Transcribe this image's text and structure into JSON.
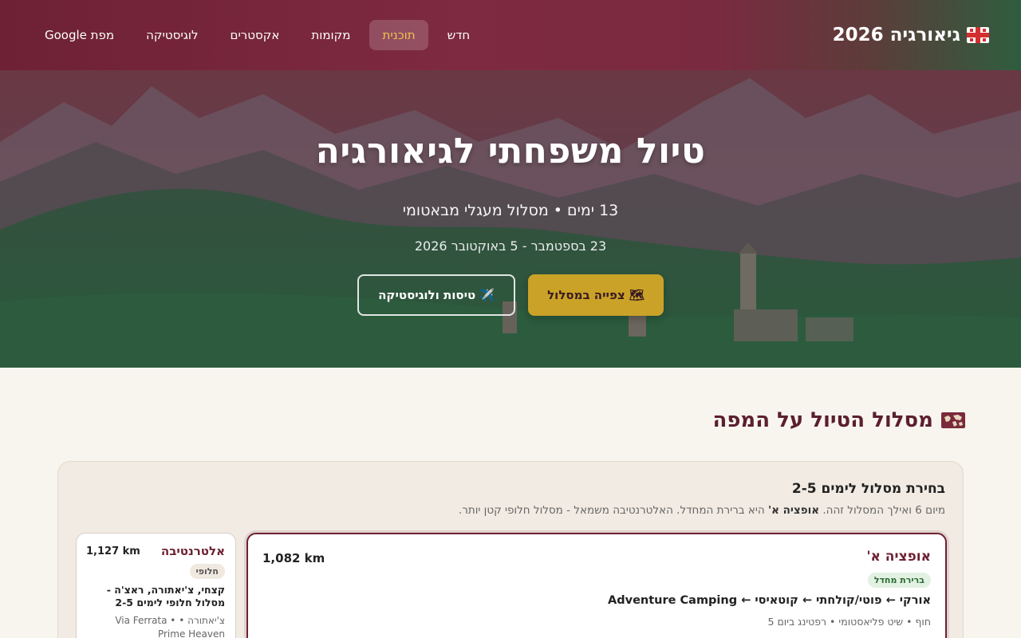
{
  "brand": {
    "title": "גיאורגיה 2026",
    "flag_icon": "georgia-flag-icon"
  },
  "nav": {
    "items": [
      {
        "label": "חדש",
        "active": false
      },
      {
        "label": "תוכנית",
        "active": true
      },
      {
        "label": "מקומות",
        "active": false
      },
      {
        "label": "אקסטרים",
        "active": false
      },
      {
        "label": "לוגיסטיקה",
        "active": false
      },
      {
        "label": "מפת Google",
        "active": false
      }
    ]
  },
  "hero": {
    "title": "טיול משפחתי לגיאורגיה",
    "subtitle": "13 ימים • מסלול מעגלי מבאטומי",
    "dates": "23 בספטמבר - 5 באוקטובר 2026",
    "primary_button": "🗺 צפייה במסלול",
    "secondary_button": "✈️ טיסות ולוגיסטיקה"
  },
  "section": {
    "title": "מסלול הטיול על המפה"
  },
  "route_choice": {
    "title": "בחירת מסלול לימים 2-5",
    "desc_prefix": "מיום 6 ואילך המסלול זהה.",
    "desc_bold": "אופציה א'",
    "desc_suffix": "היא ברירת המחדל. האלטרנטיבה משמאל - מסלול חלופי קטן יותר.",
    "option_a": {
      "name": "אופציה א'",
      "km": "1,082 km",
      "badge": "ברירת מחדל",
      "route": "אורקי ← פוטי/קולחתי ← קוטאיסי ← Adventure Camping",
      "note": "חוף • שיט פליאסטומי • רפטינג ביום 5"
    },
    "alternative": {
      "name": "אלטרנטיבה",
      "km": "1,127 km",
      "badge": "חלופי",
      "route": "קצחי, צ'יאתורה, ראצ'ה - מסלול חלופי לימים 2-5",
      "note": "צ'יאתורה • Via Ferrata • Prime Heaven"
    }
  },
  "colors": {
    "header_start": "#6e2134",
    "header_end": "#2f5d3e",
    "accent_gold": "#c9a227",
    "title_maroon": "#5b1f2f"
  }
}
